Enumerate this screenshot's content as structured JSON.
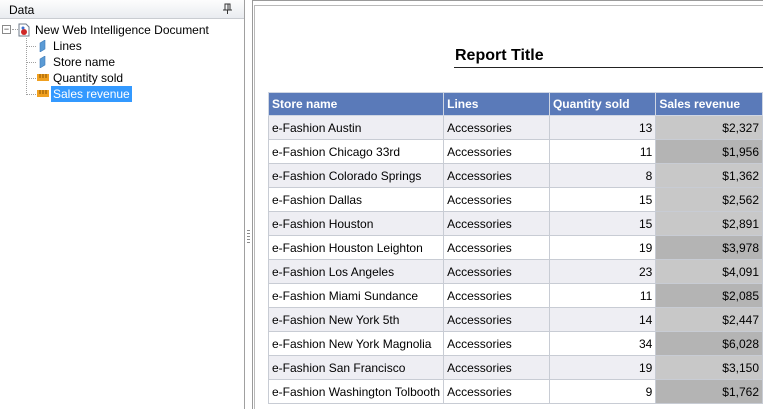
{
  "data_panel": {
    "title": "Data",
    "pin_icon": "pin-icon",
    "tree": {
      "root": {
        "label": "New Web Intelligence Document",
        "icon": "document-icon",
        "expanded": true
      },
      "children": [
        {
          "label": "Lines",
          "icon": "dimension-icon",
          "selected": false
        },
        {
          "label": "Store name",
          "icon": "dimension-icon",
          "selected": false
        },
        {
          "label": "Quantity sold",
          "icon": "measure-icon",
          "selected": false
        },
        {
          "label": "Sales revenue",
          "icon": "measure-icon",
          "selected": true
        }
      ]
    }
  },
  "report": {
    "title": "Report Title",
    "colors": {
      "header_bg": "#5a7ab9",
      "header_text": "#ffffff",
      "odd_row": "#eeeef3",
      "even_row": "#ffffff",
      "selection": "#3399ff"
    },
    "columns": [
      "Store name",
      "Lines",
      "Quantity sold",
      "Sales revenue"
    ],
    "rows": [
      {
        "store": "e-Fashion Austin",
        "line": "Accessories",
        "qty": "13",
        "revenue": "$2,327",
        "revenue_bg": "#c8c8c8"
      },
      {
        "store": "e-Fashion Chicago 33rd",
        "line": "Accessories",
        "qty": "11",
        "revenue": "$1,956",
        "revenue_bg": "#b4b4b4"
      },
      {
        "store": "e-Fashion Colorado Springs",
        "line": "Accessories",
        "qty": "8",
        "revenue": "$1,362",
        "revenue_bg": "#c8c8c8"
      },
      {
        "store": "e-Fashion Dallas",
        "line": "Accessories",
        "qty": "15",
        "revenue": "$2,562",
        "revenue_bg": "#c8c8c8"
      },
      {
        "store": "e-Fashion Houston",
        "line": "Accessories",
        "qty": "15",
        "revenue": "$2,891",
        "revenue_bg": "#c8c8c8"
      },
      {
        "store": "e-Fashion Houston Leighton",
        "line": "Accessories",
        "qty": "19",
        "revenue": "$3,978",
        "revenue_bg": "#b4b4b4"
      },
      {
        "store": "e-Fashion Los Angeles",
        "line": "Accessories",
        "qty": "23",
        "revenue": "$4,091",
        "revenue_bg": "#c8c8c8"
      },
      {
        "store": "e-Fashion Miami Sundance",
        "line": "Accessories",
        "qty": "11",
        "revenue": "$2,085",
        "revenue_bg": "#b4b4b4"
      },
      {
        "store": "e-Fashion New York 5th",
        "line": "Accessories",
        "qty": "14",
        "revenue": "$2,447",
        "revenue_bg": "#c8c8c8"
      },
      {
        "store": "e-Fashion New York Magnolia",
        "line": "Accessories",
        "qty": "34",
        "revenue": "$6,028",
        "revenue_bg": "#b4b4b4"
      },
      {
        "store": "e-Fashion San Francisco",
        "line": "Accessories",
        "qty": "19",
        "revenue": "$3,150",
        "revenue_bg": "#c8c8c8"
      },
      {
        "store": "e-Fashion Washington Tolbooth",
        "line": "Accessories",
        "qty": "9",
        "revenue": "$1,762",
        "revenue_bg": "#b4b4b4"
      }
    ]
  }
}
